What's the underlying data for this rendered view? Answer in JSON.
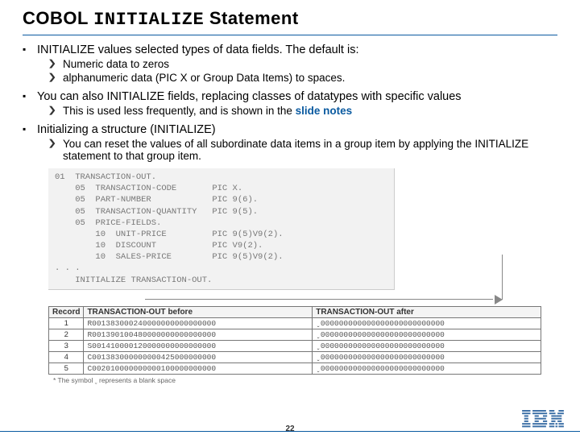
{
  "title": {
    "pre": "COBOL",
    "mono": "INITIALIZE",
    "post": "Statement"
  },
  "bullets": {
    "0": {
      "text": "INITIALIZE values selected types of data fields.  The default is:",
      "sub0": "Numeric data to zeros",
      "sub1": "alphanumeric data (PIC X or Group Data Items) to spaces."
    },
    "1": {
      "text": "You can also INITIALIZE fields, replacing classes of datatypes with specific values",
      "sub0_a": "This is used less frequently, and is shown in the",
      "sub0_b": "slide notes"
    },
    "2": {
      "text": "Initializing a structure (INITIALIZE)",
      "sub0": "You can reset the values of all subordinate data items in a group item by applying the INITIALIZE statement to that group item."
    }
  },
  "code": "01  TRANSACTION-OUT.\n    05  TRANSACTION-CODE       PIC X.\n    05  PART-NUMBER            PIC 9(6).\n    05  TRANSACTION-QUANTITY   PIC 9(5).\n    05  PRICE-FIELDS.\n        10  UNIT-PRICE         PIC 9(5)V9(2).\n        10  DISCOUNT           PIC V9(2).\n        10  SALES-PRICE        PIC 9(5)V9(2).\n. . .\n    INITIALIZE TRANSACTION-OUT.",
  "table": {
    "head": {
      "c0": "Record",
      "c1": "TRANSACTION-OUT before",
      "c2": "TRANSACTION-OUT after"
    },
    "rows": [
      {
        "c0": "1",
        "c1": "R001383000240000000000000000",
        "c2": "ˬ000000000000000000000000000"
      },
      {
        "c0": "2",
        "c1": "R001390100480000000000000000",
        "c2": "ˬ000000000000000000000000000"
      },
      {
        "c0": "3",
        "c1": "S001410000120000000000000000",
        "c2": "ˬ000000000000000000000000000"
      },
      {
        "c0": "4",
        "c1": "C001383000000000425000000000",
        "c2": "ˬ000000000000000000000000000"
      },
      {
        "c0": "5",
        "c1": "C002010000000000100000000000",
        "c2": "ˬ000000000000000000000000000"
      }
    ],
    "footnote": "*  The symbol ˬ represents a blank space"
  },
  "page": "22"
}
